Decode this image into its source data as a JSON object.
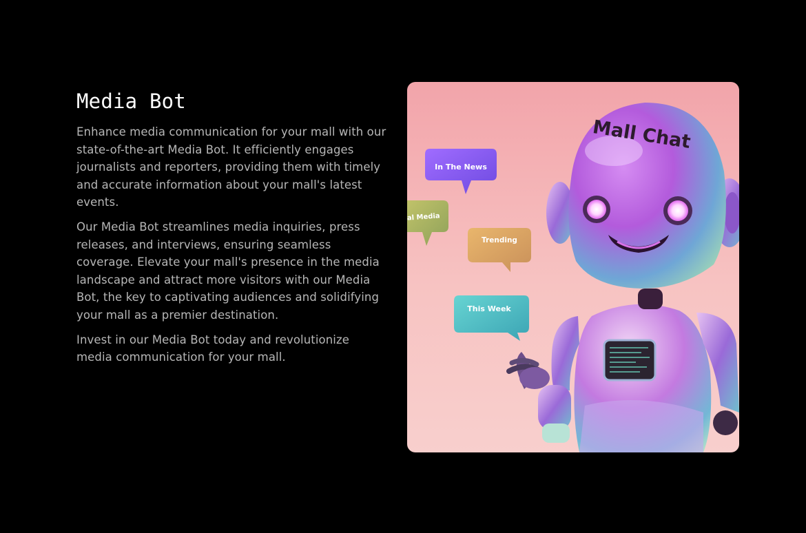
{
  "section": {
    "title": "Media Bot",
    "paragraphs": [
      "Enhance media communication for your mall with our state-of-the-art Media Bot. It efficiently engages journalists and reporters, providing them with timely and accurate information about your mall's latest events.",
      "Our Media Bot streamlines media inquiries, press releases, and interviews, ensuring seamless coverage. Elevate your mall's presence in the media landscape and attract more visitors with our Media Bot, the key to captivating audiences and solidifying your mall as a premier destination.",
      "Invest in our Media Bot today and revolutionize media communication for your mall."
    ]
  },
  "image": {
    "robot_head_text": "Mall Chat",
    "bubbles": [
      "In The News",
      "al Media",
      "Trending",
      "This Week"
    ],
    "colors": {
      "background_top": "#f3a7ad",
      "background_bottom": "#f7c3c0",
      "bubble_news": "#8c5bf0",
      "bubble_social": "#a9b45d",
      "bubble_trending": "#d9a062",
      "bubble_week": "#52bfc2"
    }
  }
}
